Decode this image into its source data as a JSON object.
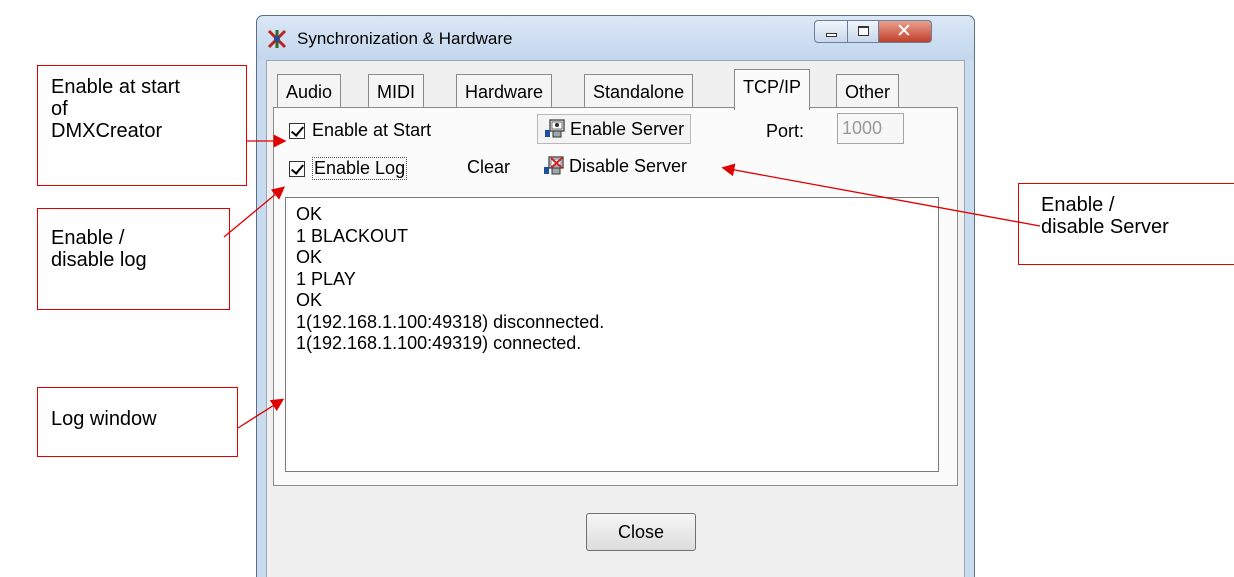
{
  "window": {
    "title": "Synchronization & Hardware"
  },
  "tabs": [
    {
      "label": "Audio"
    },
    {
      "label": "MIDI"
    },
    {
      "label": "Hardware"
    },
    {
      "label": "Standalone"
    },
    {
      "label": "TCP/IP",
      "active": true
    },
    {
      "label": "Other"
    }
  ],
  "tcpip": {
    "enable_at_start_label": "Enable at Start",
    "enable_at_start_checked": true,
    "enable_log_label": "Enable Log",
    "enable_log_checked": true,
    "clear_label": "Clear",
    "enable_server_label": "Enable Server",
    "disable_server_label": "Disable Server",
    "port_label": "Port:",
    "port_value": "1000"
  },
  "log": {
    "lines": [
      "OK",
      "1 BLACKOUT",
      "OK",
      "1 PLAY",
      "OK",
      "1(192.168.1.100:49318) disconnected.",
      "1(192.168.1.100:49319) connected."
    ]
  },
  "footer": {
    "close_label": "Close"
  },
  "callouts": {
    "enable_at_start": [
      "Enable at start",
      "of",
      "DMXCreator"
    ],
    "enable_log": [
      "Enable /",
      "disable log"
    ],
    "log_window": [
      "Log window"
    ],
    "enable_server": [
      "Enable /",
      "disable Server"
    ]
  },
  "colors": {
    "callout_border": "#e00000",
    "title_bar": "#c9dbee",
    "close_button": "#c2402a"
  }
}
